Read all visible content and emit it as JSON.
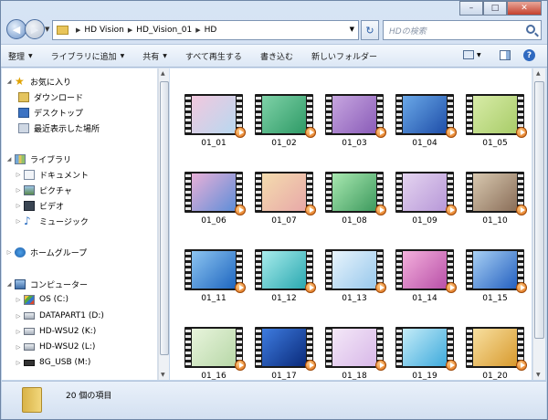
{
  "window": {
    "minimize": "–",
    "maximize": "□",
    "close": "✕"
  },
  "address": {
    "crumbs": [
      "HD Vision",
      "HD_Vision_01",
      "HD"
    ]
  },
  "search": {
    "placeholder": "HDの検索"
  },
  "toolbar": {
    "organize": "整理",
    "add_to_library": "ライブラリに追加",
    "share": "共有",
    "play_all": "すべて再生する",
    "burn": "書き込む",
    "new_folder": "新しいフォルダー"
  },
  "nav": {
    "favorites": {
      "label": "お気に入り",
      "items": [
        "ダウンロード",
        "デスクトップ",
        "最近表示した場所"
      ]
    },
    "libraries": {
      "label": "ライブラリ",
      "items": [
        "ドキュメント",
        "ピクチャ",
        "ビデオ",
        "ミュージック"
      ]
    },
    "homegroup": {
      "label": "ホームグループ"
    },
    "computer": {
      "label": "コンピューター",
      "items": [
        "OS (C:)",
        "DATAPART1 (D:)",
        "HD-WSU2 (K:)",
        "HD-WSU2 (L:)",
        "8G_USB (M:)"
      ]
    }
  },
  "files": [
    {
      "name": "01_01",
      "colors": [
        "#f2c8de",
        "#b8d8f0"
      ]
    },
    {
      "name": "01_02",
      "colors": [
        "#7fd2a8",
        "#2e9a66"
      ]
    },
    {
      "name": "01_03",
      "colors": [
        "#c7a6e0",
        "#8a5cb8"
      ]
    },
    {
      "name": "01_04",
      "colors": [
        "#6aa8e8",
        "#1e4ea8"
      ]
    },
    {
      "name": "01_05",
      "colors": [
        "#d8eca8",
        "#a8cc68"
      ]
    },
    {
      "name": "01_06",
      "colors": [
        "#e8b0d8",
        "#5f8ed8"
      ]
    },
    {
      "name": "01_07",
      "colors": [
        "#f4dcae",
        "#e8a8a8"
      ]
    },
    {
      "name": "01_08",
      "colors": [
        "#a8e8b0",
        "#3e9a5e"
      ]
    },
    {
      "name": "01_09",
      "colors": [
        "#e4d4f0",
        "#b898d8"
      ]
    },
    {
      "name": "01_10",
      "colors": [
        "#d8c8b0",
        "#8a6e58"
      ]
    },
    {
      "name": "01_11",
      "colors": [
        "#8cc4f0",
        "#1e66c0"
      ]
    },
    {
      "name": "01_12",
      "colors": [
        "#a8ecec",
        "#2aa8b0"
      ]
    },
    {
      "name": "01_13",
      "colors": [
        "#e8f4fc",
        "#98c8ec"
      ]
    },
    {
      "name": "01_14",
      "colors": [
        "#f4b0dc",
        "#b850a8"
      ]
    },
    {
      "name": "01_15",
      "colors": [
        "#a8d0f4",
        "#2460c0"
      ]
    },
    {
      "name": "01_16",
      "colors": [
        "#e8f4dc",
        "#b8d8a8"
      ]
    },
    {
      "name": "01_17",
      "colors": [
        "#3e7ce0",
        "#0a2a7a"
      ]
    },
    {
      "name": "01_18",
      "colors": [
        "#f4e8f8",
        "#d8b8e8"
      ]
    },
    {
      "name": "01_19",
      "colors": [
        "#c4ecf8",
        "#3eaadc"
      ]
    },
    {
      "name": "01_20",
      "colors": [
        "#f8e0a0",
        "#d89a2e"
      ]
    }
  ],
  "status": {
    "count": "20 個の項目"
  }
}
